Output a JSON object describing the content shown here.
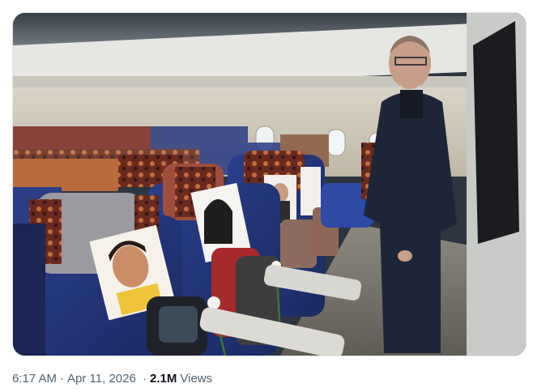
{
  "post": {
    "photo_alt": "Airplane cabin with seats holding children's portraits, backpacks and white roses; a man in a dark suit stands in the aisle",
    "time": "6:17 AM",
    "separator": "·",
    "date": "Apr 11, 2026",
    "views_count": "2.1M",
    "views_label": "Views"
  }
}
